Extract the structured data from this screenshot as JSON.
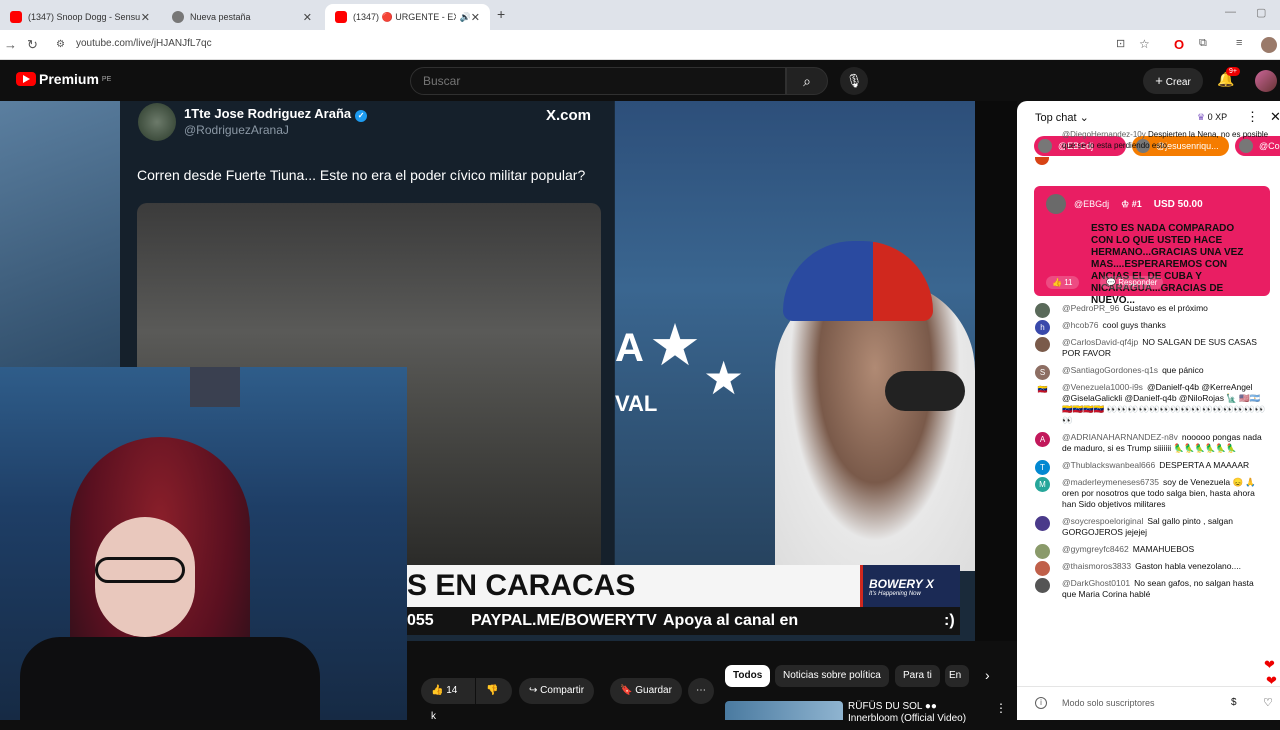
{
  "browser": {
    "tabs": [
      {
        "label": "(1347) Snoop Dogg - Sensual S",
        "color": "#ff0000"
      },
      {
        "label": "Nueva pestaña",
        "color": "#777777"
      },
      {
        "label": "(1347) 🔴 URGENTE - EXP",
        "color": "#ff0000"
      }
    ],
    "url": "youtube.com/live/jHJANJfL7qc"
  },
  "youtube": {
    "logo": "Premium",
    "region": "PE",
    "search_placeholder": "Buscar",
    "create_label": "Crear",
    "notif_count": "9+"
  },
  "video": {
    "tweet": {
      "name": "1Tte Jose Rodriguez Araña",
      "handle": "@RodriguezAranaJ",
      "site": "X.com",
      "text": "Corren desde Fuerte Tiuna... Este no era el poder cívico militar popular?"
    },
    "host_logo": "VAL",
    "host_logo_top": "A",
    "banner": "S EN CARACAS",
    "ticker": [
      "055",
      "PAYPAL.ME/BOWERYTV",
      "Apoya al canal en GUARIMBADIGITAL.COM",
      ":)"
    ],
    "brand": "BOWERY X",
    "brand_sub": "It's Happening Now"
  },
  "actions": {
    "likes": "14 k",
    "share": "Compartir",
    "save": "Guardar",
    "chips": [
      "Todos",
      "Noticias sobre política",
      "Para ti",
      "En"
    ],
    "related_title": "RÜFÜS DU SOL ●● Innerbloom (Official Video)"
  },
  "chat": {
    "title": "Top chat",
    "xp": "0 XP",
    "ticker": [
      {
        "name": "@EBGdj",
        "color": "#e91e63"
      },
      {
        "name": "@jesusenriqu...",
        "color": "#f57c00"
      },
      {
        "name": "@Coo",
        "color": "#e91e63"
      }
    ],
    "pinned_author": "@DiegoHernandez-10y",
    "pinned_text": "Despierten la Nena, no es posible que se lo esta perdiendo esto.",
    "superchat": {
      "author": "@EBGdj",
      "rank": "#1",
      "amount": "USD 50.00",
      "message": "ESTO ES NADA COMPARADO CON LO QUE USTED HACE HERMANO...GRACIAS UNA VEZ MAS....ESPERAREMOS CON ANCIAS EL DE CUBA Y NICARAGUA...GRACIAS DE NUEVO...",
      "likes": "11",
      "reply": "Responder"
    },
    "messages": [
      {
        "author": "@PedroPR_96",
        "text": "Gustavo es el próximo",
        "avatar": "",
        "color": "#5a6a5a"
      },
      {
        "author": "@hcob76",
        "text": "cool guys thanks",
        "avatar": "h",
        "color": "#3949ab"
      },
      {
        "author": "@CarlosDavid-qf4jp",
        "text": "NO SALGAN DE SUS CASAS POR FAVOR",
        "avatar": "",
        "color": "#7a5a4a"
      },
      {
        "author": "@SantiagoGordones-q1s",
        "text": "que pánico",
        "avatar": "S",
        "color": "#8d6e63"
      },
      {
        "author": "@Venezuela1000-i9s",
        "text": "@Danielf-q4b @KerreAngel @GiselaGalickli @Danielf-q4b @NiloRojas 🗽 🇺🇸🇦🇷🇻🇪🇻🇪🇻🇪🇻🇪 👀👀👀👀👀👀👀👀👀👀👀👀👀👀👀👀",
        "avatar": "🇻🇪",
        "color": "#ffffff"
      },
      {
        "author": "@ADRIANAHARNANDEZ-n8v",
        "text": "nooooo pongas nada de maduro, si es Trump siiiiiii 🦜🦜🦜🦜🦜🦜",
        "avatar": "A",
        "color": "#c2185b"
      },
      {
        "author": "@Thublackswanbeal666",
        "text": "DESPERTA A MAAAAR",
        "avatar": "T",
        "color": "#0288d1"
      },
      {
        "author": "@maderleymeneses6735",
        "text": "soy de Venezuela 😞 🙏 oren por nosotros que todo salga bien, hasta ahora han Sido objetivos militares",
        "avatar": "M",
        "color": "#26a69a"
      },
      {
        "author": "@soycrespoeloriginal",
        "text": "Sal gallo pinto , salgan GORGOJEROS jejejej",
        "avatar": "",
        "color": "#4a3a8a"
      },
      {
        "author": "@gymgreyfc8462",
        "text": "MAMAHUEBOS",
        "avatar": "",
        "color": "#8a9a6a"
      },
      {
        "author": "@thaismoros3833",
        "text": "Gaston habla venezolano....",
        "avatar": "",
        "color": "#c0604a"
      },
      {
        "author": "@DarkGhost0101",
        "text": "No sean gafos, no salgan hasta que Maria Corina hablé",
        "avatar": "",
        "color": "#555555"
      }
    ],
    "input_label": "Modo solo suscriptores"
  }
}
